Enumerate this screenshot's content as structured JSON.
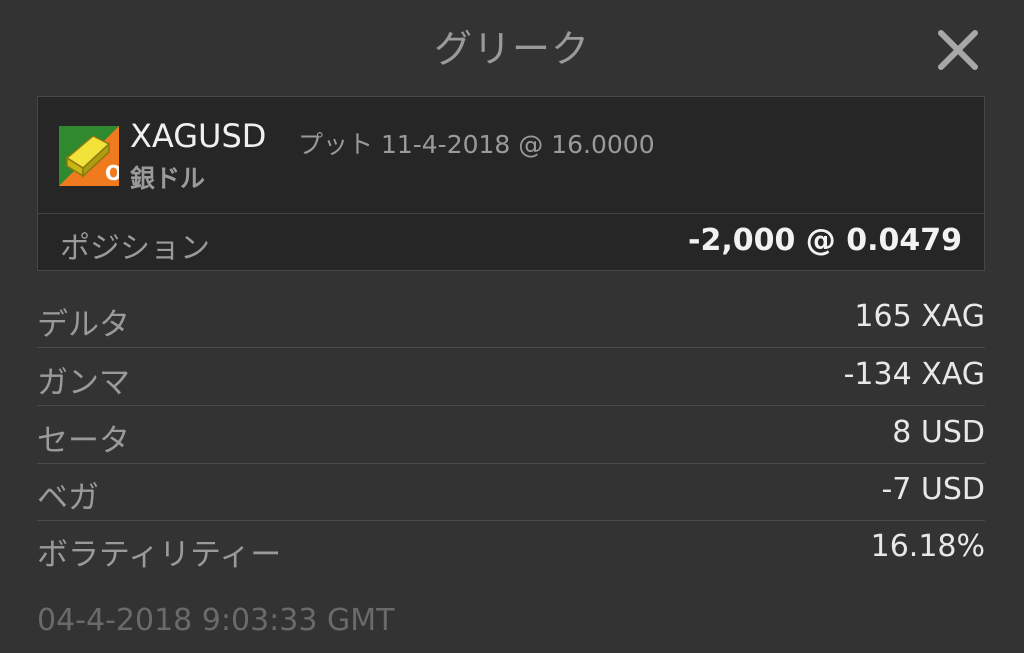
{
  "header": {
    "title": "グリーク",
    "close_icon": "close-icon"
  },
  "instrument": {
    "symbol": "XAGUSD",
    "detail": "プット 11-4-2018 @ 16.0000",
    "name": "銀ドル",
    "logo_icon": "silver-bar-icon",
    "position_label": "ポジション",
    "position_value": "-2,000 @ 0.0479"
  },
  "greeks": [
    {
      "label": "デルタ",
      "value": "165 XAG"
    },
    {
      "label": "ガンマ",
      "value": "-134 XAG"
    },
    {
      "label": "セータ",
      "value": "8 USD"
    },
    {
      "label": "ベガ",
      "value": "-7 USD"
    },
    {
      "label": "ボラティリティー",
      "value": "16.18%"
    }
  ],
  "timestamp": "04-4-2018 9:03:33 GMT",
  "colors": {
    "background": "#333333",
    "card": "#262626",
    "logo_green": "#2f8a2f",
    "logo_orange": "#f07a1e",
    "logo_gold": "#e8d21c"
  }
}
